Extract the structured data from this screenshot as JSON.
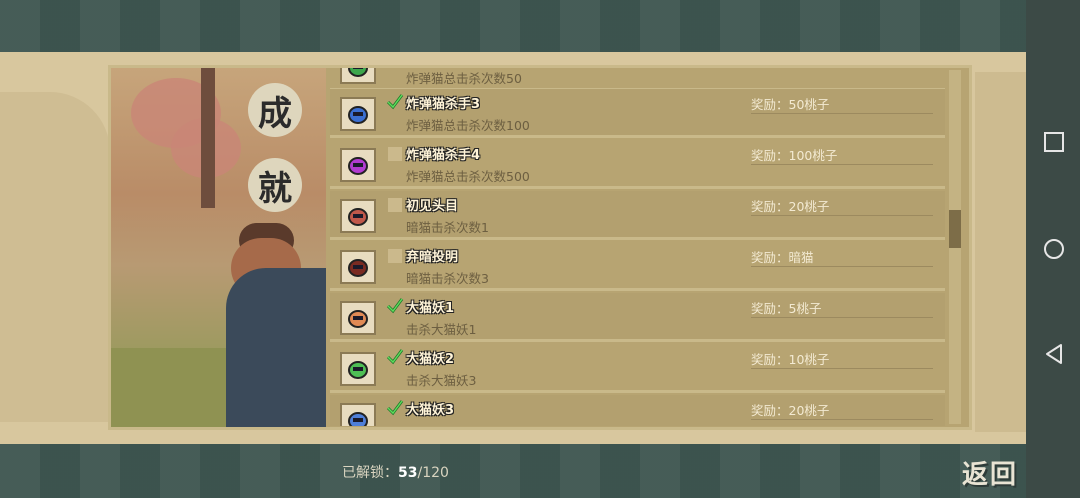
{
  "panel": {
    "title_chars": [
      "成",
      "就"
    ]
  },
  "achievements": [
    {
      "name": "",
      "desc": "炸弹猫总击杀次数50",
      "reward": "",
      "done": true,
      "icon": "bomb-cat-icon",
      "color": "#3da64c"
    },
    {
      "name": "炸弹猫杀手3",
      "desc": "炸弹猫总击杀次数100",
      "reward": "奖励：50桃子",
      "done": true,
      "icon": "bomb-cat-blue-icon",
      "color": "#3b6fd1"
    },
    {
      "name": "炸弹猫杀手4",
      "desc": "炸弹猫总击杀次数500",
      "reward": "奖励：100桃子",
      "done": false,
      "icon": "bomb-cat-purple-icon",
      "color": "#b23bd1"
    },
    {
      "name": "初见头目",
      "desc": "暗猫击杀次数1",
      "reward": "奖励：20桃子",
      "done": false,
      "icon": "dark-cat-face-icon",
      "color": "#c0584b"
    },
    {
      "name": "弃暗投明",
      "desc": "暗猫击杀次数3",
      "reward": "奖励：暗猫",
      "done": false,
      "icon": "dark-cat-portrait-icon",
      "color": "#7a2b22"
    },
    {
      "name": "大猫妖1",
      "desc": "击杀大猫妖1",
      "reward": "奖励：5桃子",
      "done": true,
      "icon": "big-cat-demon-orange-icon",
      "color": "#e08a55"
    },
    {
      "name": "大猫妖2",
      "desc": "击杀大猫妖3",
      "reward": "奖励：10桃子",
      "done": true,
      "icon": "big-cat-demon-green-icon",
      "color": "#4fbf55"
    },
    {
      "name": "大猫妖3",
      "desc": "",
      "reward": "奖励：20桃子",
      "done": true,
      "icon": "big-cat-demon-blue-icon",
      "color": "#4f7fd8"
    }
  ],
  "footer": {
    "unlocked_label": "已解锁：",
    "unlocked_count": "53",
    "unlocked_total": "/120",
    "back_label": "返回"
  },
  "navbar": {
    "icons": [
      "recent-apps-icon",
      "home-icon",
      "back-triangle-icon"
    ]
  }
}
